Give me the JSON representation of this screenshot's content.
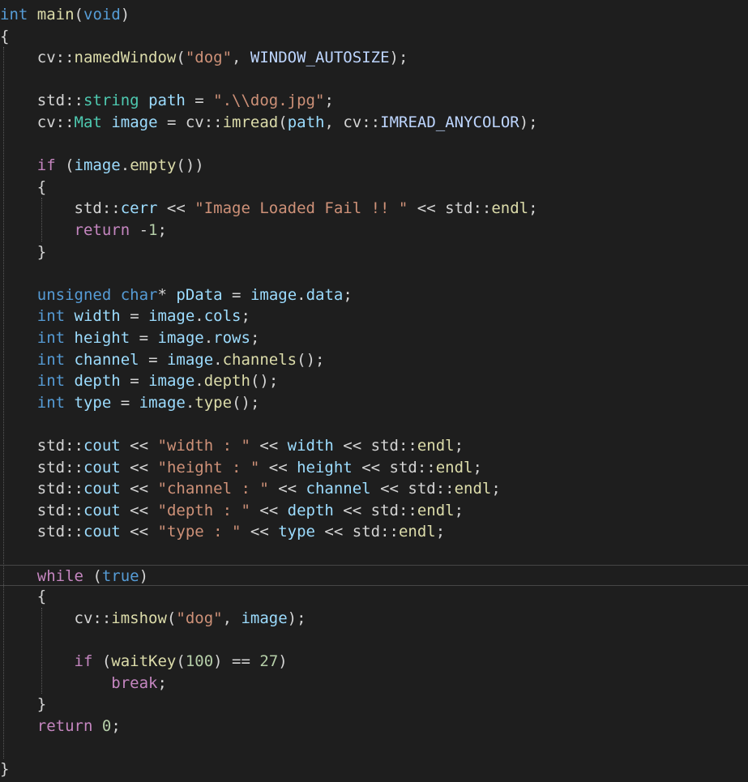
{
  "editor": {
    "language": "cpp",
    "theme_colors": {
      "background": "#1e1e1e",
      "default_text": "#d4d4d4",
      "keyword": "#569cd6",
      "control_keyword": "#c586c0",
      "type": "#4ec9b0",
      "function": "#dcdcaa",
      "string": "#ce9178",
      "number": "#b5cea8",
      "variable": "#9cdcfe",
      "macro": "#bed6ff",
      "current_line_border": "#464646",
      "indent_guide": "#5a5a5a"
    },
    "current_line_index": 26,
    "lines": [
      [
        [
          "keyword",
          "int"
        ],
        [
          "plain",
          " "
        ],
        [
          "func",
          "main"
        ],
        [
          "punct",
          "("
        ],
        [
          "keyword",
          "void"
        ],
        [
          "punct",
          ")"
        ]
      ],
      [
        [
          "punct",
          "{"
        ]
      ],
      [
        [
          "plain",
          "    "
        ],
        [
          "ns",
          "cv::"
        ],
        [
          "func",
          "namedWindow"
        ],
        [
          "punct",
          "("
        ],
        [
          "string",
          "\"dog\""
        ],
        [
          "punct",
          ", "
        ],
        [
          "macro",
          "WINDOW_AUTOSIZE"
        ],
        [
          "punct",
          ");"
        ]
      ],
      [],
      [
        [
          "plain",
          "    "
        ],
        [
          "ns",
          "std::"
        ],
        [
          "type",
          "string"
        ],
        [
          "plain",
          " "
        ],
        [
          "var",
          "path"
        ],
        [
          "op",
          " = "
        ],
        [
          "string",
          "\".\\\\dog.jpg\""
        ],
        [
          "punct",
          ";"
        ]
      ],
      [
        [
          "plain",
          "    "
        ],
        [
          "ns",
          "cv::"
        ],
        [
          "type",
          "Mat"
        ],
        [
          "plain",
          " "
        ],
        [
          "var",
          "image"
        ],
        [
          "op",
          " = "
        ],
        [
          "ns",
          "cv::"
        ],
        [
          "func",
          "imread"
        ],
        [
          "punct",
          "("
        ],
        [
          "var",
          "path"
        ],
        [
          "punct",
          ", "
        ],
        [
          "ns",
          "cv::"
        ],
        [
          "macro",
          "IMREAD_ANYCOLOR"
        ],
        [
          "punct",
          ");"
        ]
      ],
      [],
      [
        [
          "plain",
          "    "
        ],
        [
          "control",
          "if"
        ],
        [
          "punct",
          " ("
        ],
        [
          "var",
          "image"
        ],
        [
          "punct",
          "."
        ],
        [
          "func",
          "empty"
        ],
        [
          "punct",
          "())"
        ]
      ],
      [
        [
          "plain",
          "    "
        ],
        [
          "punct",
          "{"
        ]
      ],
      [
        [
          "plain",
          "        "
        ],
        [
          "ns",
          "std::"
        ],
        [
          "var",
          "cerr"
        ],
        [
          "op",
          " << "
        ],
        [
          "string",
          "\"Image Loaded Fail !! \""
        ],
        [
          "op",
          " << "
        ],
        [
          "ns",
          "std::"
        ],
        [
          "func",
          "endl"
        ],
        [
          "punct",
          ";"
        ]
      ],
      [
        [
          "plain",
          "        "
        ],
        [
          "control",
          "return"
        ],
        [
          "op",
          " -"
        ],
        [
          "number",
          "1"
        ],
        [
          "punct",
          ";"
        ]
      ],
      [
        [
          "plain",
          "    "
        ],
        [
          "punct",
          "}"
        ]
      ],
      [],
      [
        [
          "plain",
          "    "
        ],
        [
          "keyword",
          "unsigned"
        ],
        [
          "plain",
          " "
        ],
        [
          "keyword",
          "char"
        ],
        [
          "op",
          "*"
        ],
        [
          "plain",
          " "
        ],
        [
          "var",
          "pData"
        ],
        [
          "op",
          " = "
        ],
        [
          "var",
          "image"
        ],
        [
          "punct",
          "."
        ],
        [
          "var",
          "data"
        ],
        [
          "punct",
          ";"
        ]
      ],
      [
        [
          "plain",
          "    "
        ],
        [
          "keyword",
          "int"
        ],
        [
          "plain",
          " "
        ],
        [
          "var",
          "width"
        ],
        [
          "op",
          " = "
        ],
        [
          "var",
          "image"
        ],
        [
          "punct",
          "."
        ],
        [
          "var",
          "cols"
        ],
        [
          "punct",
          ";"
        ]
      ],
      [
        [
          "plain",
          "    "
        ],
        [
          "keyword",
          "int"
        ],
        [
          "plain",
          " "
        ],
        [
          "var",
          "height"
        ],
        [
          "op",
          " = "
        ],
        [
          "var",
          "image"
        ],
        [
          "punct",
          "."
        ],
        [
          "var",
          "rows"
        ],
        [
          "punct",
          ";"
        ]
      ],
      [
        [
          "plain",
          "    "
        ],
        [
          "keyword",
          "int"
        ],
        [
          "plain",
          " "
        ],
        [
          "var",
          "channel"
        ],
        [
          "op",
          " = "
        ],
        [
          "var",
          "image"
        ],
        [
          "punct",
          "."
        ],
        [
          "func",
          "channels"
        ],
        [
          "punct",
          "();"
        ]
      ],
      [
        [
          "plain",
          "    "
        ],
        [
          "keyword",
          "int"
        ],
        [
          "plain",
          " "
        ],
        [
          "var",
          "depth"
        ],
        [
          "op",
          " = "
        ],
        [
          "var",
          "image"
        ],
        [
          "punct",
          "."
        ],
        [
          "func",
          "depth"
        ],
        [
          "punct",
          "();"
        ]
      ],
      [
        [
          "plain",
          "    "
        ],
        [
          "keyword",
          "int"
        ],
        [
          "plain",
          " "
        ],
        [
          "var",
          "type"
        ],
        [
          "op",
          " = "
        ],
        [
          "var",
          "image"
        ],
        [
          "punct",
          "."
        ],
        [
          "func",
          "type"
        ],
        [
          "punct",
          "();"
        ]
      ],
      [],
      [
        [
          "plain",
          "    "
        ],
        [
          "ns",
          "std::"
        ],
        [
          "var",
          "cout"
        ],
        [
          "op",
          " << "
        ],
        [
          "string",
          "\"width : \""
        ],
        [
          "op",
          " << "
        ],
        [
          "var",
          "width"
        ],
        [
          "op",
          " << "
        ],
        [
          "ns",
          "std::"
        ],
        [
          "func",
          "endl"
        ],
        [
          "punct",
          ";"
        ]
      ],
      [
        [
          "plain",
          "    "
        ],
        [
          "ns",
          "std::"
        ],
        [
          "var",
          "cout"
        ],
        [
          "op",
          " << "
        ],
        [
          "string",
          "\"height : \""
        ],
        [
          "op",
          " << "
        ],
        [
          "var",
          "height"
        ],
        [
          "op",
          " << "
        ],
        [
          "ns",
          "std::"
        ],
        [
          "func",
          "endl"
        ],
        [
          "punct",
          ";"
        ]
      ],
      [
        [
          "plain",
          "    "
        ],
        [
          "ns",
          "std::"
        ],
        [
          "var",
          "cout"
        ],
        [
          "op",
          " << "
        ],
        [
          "string",
          "\"channel : \""
        ],
        [
          "op",
          " << "
        ],
        [
          "var",
          "channel"
        ],
        [
          "op",
          " << "
        ],
        [
          "ns",
          "std::"
        ],
        [
          "func",
          "endl"
        ],
        [
          "punct",
          ";"
        ]
      ],
      [
        [
          "plain",
          "    "
        ],
        [
          "ns",
          "std::"
        ],
        [
          "var",
          "cout"
        ],
        [
          "op",
          " << "
        ],
        [
          "string",
          "\"depth : \""
        ],
        [
          "op",
          " << "
        ],
        [
          "var",
          "depth"
        ],
        [
          "op",
          " << "
        ],
        [
          "ns",
          "std::"
        ],
        [
          "func",
          "endl"
        ],
        [
          "punct",
          ";"
        ]
      ],
      [
        [
          "plain",
          "    "
        ],
        [
          "ns",
          "std::"
        ],
        [
          "var",
          "cout"
        ],
        [
          "op",
          " << "
        ],
        [
          "string",
          "\"type : \""
        ],
        [
          "op",
          " << "
        ],
        [
          "var",
          "type"
        ],
        [
          "op",
          " << "
        ],
        [
          "ns",
          "std::"
        ],
        [
          "func",
          "endl"
        ],
        [
          "punct",
          ";"
        ]
      ],
      [],
      [
        [
          "plain",
          "    "
        ],
        [
          "control",
          "while"
        ],
        [
          "punct",
          " ("
        ],
        [
          "keyword",
          "true"
        ],
        [
          "punct",
          ")"
        ]
      ],
      [
        [
          "plain",
          "    "
        ],
        [
          "punct",
          "{"
        ]
      ],
      [
        [
          "plain",
          "        "
        ],
        [
          "ns",
          "cv::"
        ],
        [
          "func",
          "imshow"
        ],
        [
          "punct",
          "("
        ],
        [
          "string",
          "\"dog\""
        ],
        [
          "punct",
          ", "
        ],
        [
          "var",
          "image"
        ],
        [
          "punct",
          ");"
        ]
      ],
      [],
      [
        [
          "plain",
          "        "
        ],
        [
          "control",
          "if"
        ],
        [
          "punct",
          " ("
        ],
        [
          "func",
          "waitKey"
        ],
        [
          "punct",
          "("
        ],
        [
          "number",
          "100"
        ],
        [
          "punct",
          ")"
        ],
        [
          "op",
          " == "
        ],
        [
          "number",
          "27"
        ],
        [
          "punct",
          ")"
        ]
      ],
      [
        [
          "plain",
          "            "
        ],
        [
          "control",
          "break"
        ],
        [
          "punct",
          ";"
        ]
      ],
      [
        [
          "plain",
          "    "
        ],
        [
          "punct",
          "}"
        ]
      ],
      [
        [
          "plain",
          "    "
        ],
        [
          "control",
          "return"
        ],
        [
          "plain",
          " "
        ],
        [
          "number",
          "0"
        ],
        [
          "punct",
          ";"
        ]
      ],
      [],
      [
        [
          "punct",
          "}"
        ]
      ]
    ]
  }
}
